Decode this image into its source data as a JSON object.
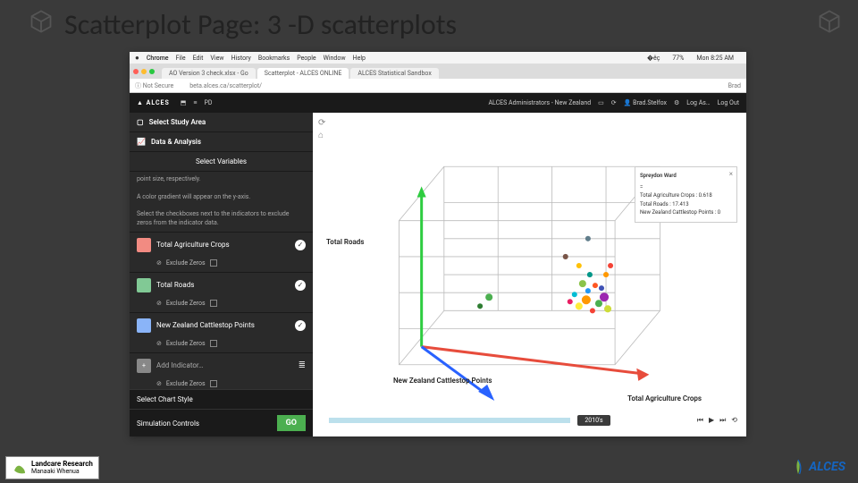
{
  "slide": {
    "title": "Scatterplot Page: 3 -D scatterplots"
  },
  "mac_menu": {
    "app": "Chrome",
    "items": [
      "File",
      "Edit",
      "View",
      "History",
      "Bookmarks",
      "People",
      "Window",
      "Help"
    ],
    "right": {
      "battery": "77%",
      "time": "Mon 8:25 AM"
    }
  },
  "tabs": [
    {
      "label": "AO Version 3 check.xlsx - Go",
      "active": false
    },
    {
      "label": "Scatterplot - ALCES ONLINE",
      "active": true
    },
    {
      "label": "ALCES Statistical Sandbox",
      "active": false
    }
  ],
  "address_bar": {
    "security": "Not Secure",
    "url": "beta.alces.ca/scatterplot/",
    "profile": "Brad"
  },
  "app_header": {
    "logo": "ALCES",
    "nav": [
      "",
      "",
      "PD"
    ],
    "right": [
      "ALCES Administrators - New Zealand",
      "Brad.Stelfox",
      "Log As…",
      "Log Out"
    ]
  },
  "sidebar": {
    "sections": {
      "study_area": "Select Study Area",
      "data_analysis": "Data & Analysis",
      "select_variables": "Select Variables"
    },
    "help_text": [
      "point size, respectively.",
      "A color gradient will appear on the y-axis.",
      "Select the checkboxes next to the indicators to exclude zeros from the indicator data."
    ],
    "indicators": [
      {
        "color": "#f28b82",
        "label": "Total Agriculture Crops",
        "exclude_label": "Exclude Zeros"
      },
      {
        "color": "#81c995",
        "label": "Total Roads",
        "exclude_label": "Exclude Zeros"
      },
      {
        "color": "#8ab4f8",
        "label": "New Zealand Cattlestop Points",
        "exclude_label": "Exclude Zeros"
      },
      {
        "color": "#888888",
        "label": "Add Indicator…",
        "exclude_label": "Exclude Zeros",
        "is_add": true
      }
    ],
    "chart_style": "Select Chart Style",
    "sim_controls": "Simulation Controls",
    "go": "GO"
  },
  "chart": {
    "axis_y": "Total Roads",
    "axis_x": "Total Agriculture Crops",
    "axis_z": "New Zealand Cattlestop Points"
  },
  "tooltip": {
    "title": "Spreydon Ward",
    "rows": [
      "=",
      "Total Agriculture Crops : 0.618",
      "Total Roads : 17.413",
      "New Zealand Cattlestop Points : 0"
    ]
  },
  "timeline": {
    "year": "2010's"
  },
  "footer": {
    "landcare_line1": "Landcare Research",
    "landcare_line2": "Manaaki Whenua",
    "alces": "ALCES"
  }
}
